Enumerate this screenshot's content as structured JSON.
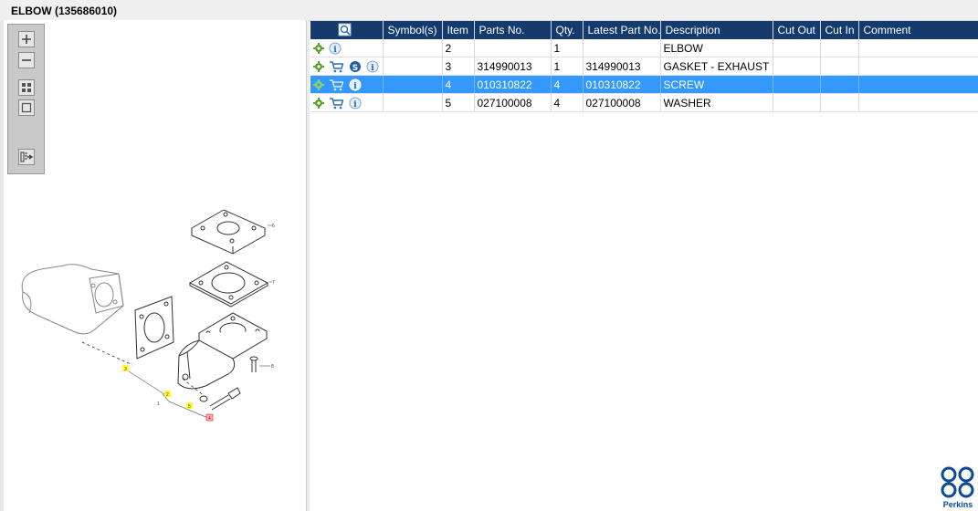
{
  "window": {
    "title": "ELBOW (135686010)"
  },
  "colors": {
    "header_bg": "#143a6e",
    "selected_row": "#3399ff",
    "brand_blue": "#0a4a96"
  },
  "viewer_toolbar": {
    "buttons": [
      "zoom-in-icon",
      "zoom-out-icon",
      "fit-all-icon",
      "fit-window-icon",
      "export-icon"
    ]
  },
  "drawing": {
    "callouts": [
      "1",
      "2",
      "3",
      "4",
      "5",
      "6",
      "7",
      "8"
    ],
    "highlighted_callouts": [
      "2",
      "3",
      "5"
    ],
    "selected_callout": "4"
  },
  "grid": {
    "header_icon": "search-parts-icon",
    "columns": [
      "",
      "Symbol(s)",
      "Item",
      "Parts No.",
      "Qty.",
      "Latest Part No.",
      "Description",
      "Cut Out",
      "Cut In",
      "Comment"
    ],
    "rows": [
      {
        "icons": [
          "gear-icon",
          "info-icon"
        ],
        "symbols": "",
        "item": "2",
        "part_no": "",
        "qty": "1",
        "latest_part_no": "",
        "description": "ELBOW",
        "cut_out": "",
        "cut_in": "",
        "comment": "",
        "selected": false
      },
      {
        "icons": [
          "gear-icon",
          "cart-icon",
          "s-badge-icon",
          "info-icon"
        ],
        "symbols": "",
        "item": "3",
        "part_no": "314990013",
        "qty": "1",
        "latest_part_no": "314990013",
        "description": "GASKET - EXHAUST",
        "cut_out": "",
        "cut_in": "",
        "comment": "",
        "selected": false
      },
      {
        "icons": [
          "gear-icon",
          "cart-icon",
          "info-icon"
        ],
        "symbols": "",
        "item": "4",
        "part_no": "010310822",
        "qty": "4",
        "latest_part_no": "010310822",
        "description": "SCREW",
        "cut_out": "",
        "cut_in": "",
        "comment": "",
        "selected": true
      },
      {
        "icons": [
          "gear-icon",
          "cart-icon",
          "info-icon"
        ],
        "symbols": "",
        "item": "5",
        "part_no": "027100008",
        "qty": "4",
        "latest_part_no": "027100008",
        "description": "WASHER",
        "cut_out": "",
        "cut_in": "",
        "comment": "",
        "selected": false
      }
    ]
  },
  "logo": {
    "text": "Perkins"
  }
}
